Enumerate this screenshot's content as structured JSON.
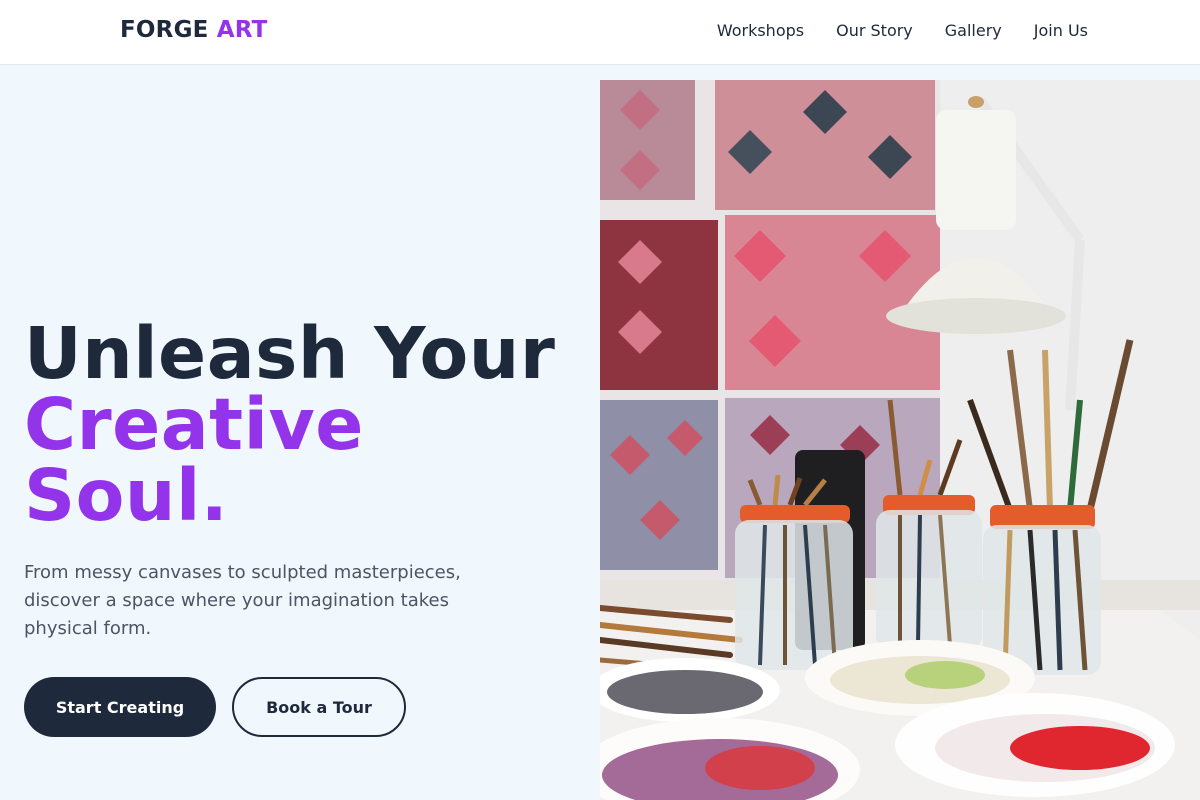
{
  "brand": {
    "name_part1": "FORGE",
    "name_part2": "ART"
  },
  "nav": {
    "items": [
      "Workshops",
      "Our Story",
      "Gallery",
      "Join Us"
    ]
  },
  "hero": {
    "headline_line1": "Unleash Your",
    "headline_line2": "Creative",
    "headline_line3": "Soul.",
    "subtext": "From messy canvases to sculpted masterpieces, discover a space where your imagination takes physical form.",
    "primary_cta": "Start Creating",
    "secondary_cta": "Book a Tour"
  },
  "colors": {
    "accent": "#9333ea",
    "dark": "#1e293b",
    "background": "#f0f7fd"
  }
}
